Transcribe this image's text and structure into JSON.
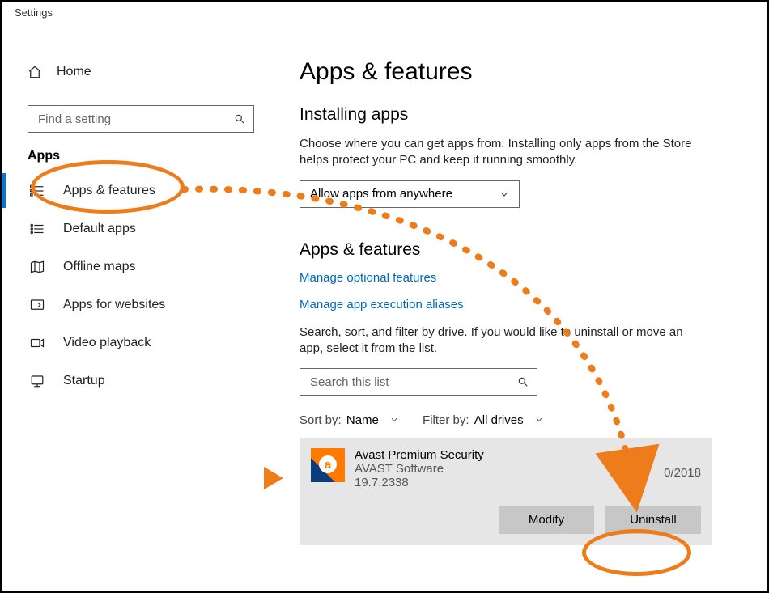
{
  "window": {
    "title": "Settings"
  },
  "sidebar": {
    "home": "Home",
    "search_placeholder": "Find a setting",
    "section": "Apps",
    "items": [
      {
        "label": "Apps & features",
        "icon": "list-icon",
        "active": true
      },
      {
        "label": "Default apps",
        "icon": "defaults-icon"
      },
      {
        "label": "Offline maps",
        "icon": "map-icon"
      },
      {
        "label": "Apps for websites",
        "icon": "web-icon"
      },
      {
        "label": "Video playback",
        "icon": "video-icon"
      },
      {
        "label": "Startup",
        "icon": "startup-icon"
      }
    ]
  },
  "main": {
    "title": "Apps & features",
    "installing": {
      "heading": "Installing apps",
      "description": "Choose where you can get apps from. Installing only apps from the Store helps protect your PC and keep it running smoothly.",
      "dropdown_value": "Allow apps from anywhere"
    },
    "apps_section": {
      "heading": "Apps & features",
      "link_optional": "Manage optional features",
      "link_aliases": "Manage app execution aliases",
      "description": "Search, sort, and filter by drive. If you would like to uninstall or move an app, select it from the list.",
      "search_placeholder": "Search this list",
      "sort_label": "Sort by:",
      "sort_value": "Name",
      "filter_label": "Filter by:",
      "filter_value": "All drives"
    },
    "app": {
      "name": "Avast Premium Security",
      "publisher": "AVAST Software",
      "version": "19.7.2338",
      "date": "0/2018",
      "modify": "Modify",
      "uninstall": "Uninstall"
    }
  }
}
